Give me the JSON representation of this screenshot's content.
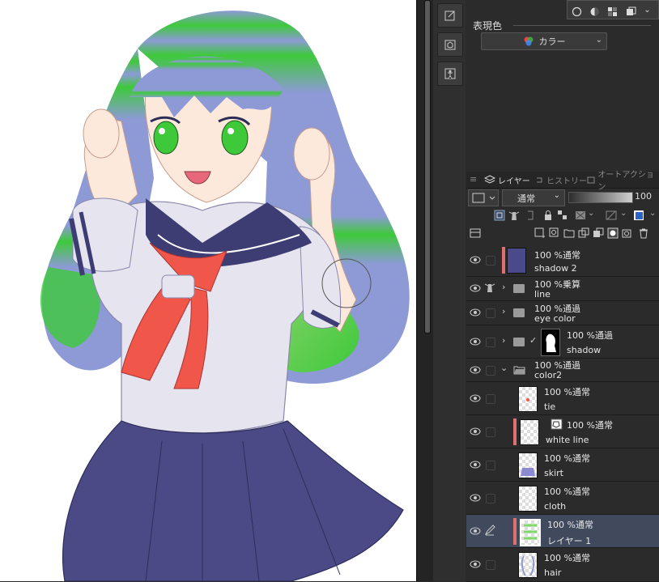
{
  "panel": {
    "expression_label": "表現色",
    "color_mode": "カラー"
  },
  "tabs": [
    {
      "label": "レイヤー"
    },
    {
      "label": "ヒストリー"
    },
    {
      "label": "オートアクション"
    }
  ],
  "layer_props": {
    "blend_mode": "通常",
    "opacity": "100"
  },
  "layers": [
    {
      "id": "shadow2",
      "opacity_mode": "100 %通常",
      "name": "shadow 2"
    },
    {
      "id": "line",
      "opacity_mode": "100 %乗算",
      "name": "line"
    },
    {
      "id": "eye_color",
      "opacity_mode": "100 %通過",
      "name": "eye color"
    },
    {
      "id": "shadow",
      "opacity_mode": "100 %通過",
      "name": "shadow"
    },
    {
      "id": "color2",
      "opacity_mode": "100 %通過",
      "name": "color2"
    },
    {
      "id": "tie",
      "opacity_mode": "100 %通常",
      "name": "tie"
    },
    {
      "id": "white_line",
      "opacity_mode": "100 %通常",
      "name": "white line"
    },
    {
      "id": "skirt",
      "opacity_mode": "100 %通常",
      "name": "skirt"
    },
    {
      "id": "cloth",
      "opacity_mode": "100 %通常",
      "name": "cloth"
    },
    {
      "id": "layer1",
      "opacity_mode": "100 %通常",
      "name": "レイヤー 1"
    },
    {
      "id": "hair",
      "opacity_mode": "100 %通常",
      "name": "hair"
    }
  ],
  "colors": {
    "hair_blue": "#8d9ad6",
    "hair_green": "#3ec93b",
    "skirt": "#4b4a86",
    "collar": "#3e3d73",
    "tie": "#f0574a",
    "shirt": "#e6e5ef",
    "skin": "#fde9dc",
    "selected_row": "#414a5c",
    "mark_red": "#e07070"
  }
}
